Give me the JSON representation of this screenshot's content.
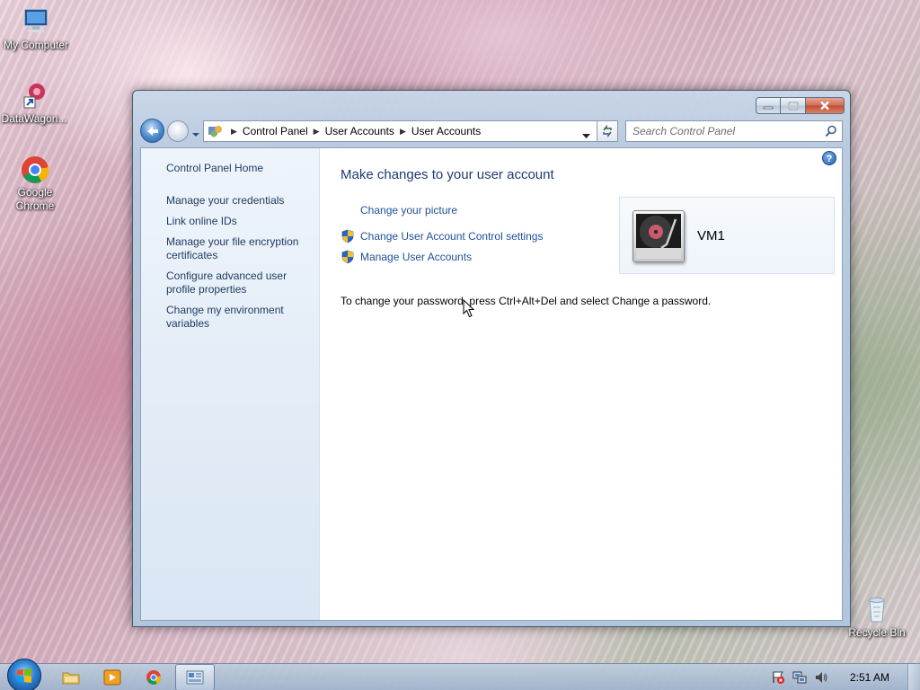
{
  "desktop": {
    "icons": [
      {
        "label": "My Computer",
        "icon": "computer-icon"
      },
      {
        "label": "DataWagon...",
        "icon": "shortcut-icon"
      },
      {
        "label": "Google Chrome",
        "icon": "chrome-icon"
      },
      {
        "label": "Recycle Bin",
        "icon": "recycle-bin-icon"
      }
    ]
  },
  "window": {
    "address_bar": {
      "crumbs": [
        "Control Panel",
        "User Accounts",
        "User Accounts"
      ]
    },
    "search": {
      "placeholder": "Search Control Panel"
    },
    "left_pane": {
      "home": "Control Panel Home",
      "links": [
        "Manage your credentials",
        "Link online IDs",
        "Manage your file encryption certificates",
        "Configure advanced user profile properties",
        "Change my environment variables"
      ]
    },
    "main": {
      "title": "Make changes to your user account",
      "tasks": [
        {
          "label": "Change your picture",
          "shield": false
        },
        {
          "label": "Change User Account Control settings",
          "shield": true
        },
        {
          "label": "Manage User Accounts",
          "shield": true
        }
      ],
      "info": "To change your password, press Ctrl+Alt+Del and select Change a password.",
      "account": {
        "name": "VM1"
      }
    },
    "help_label": "?"
  },
  "taskbar": {
    "clock": "2:51 AM",
    "items": [
      "explorer-icon",
      "media-player-icon",
      "chrome-icon",
      "control-panel-icon"
    ]
  }
}
